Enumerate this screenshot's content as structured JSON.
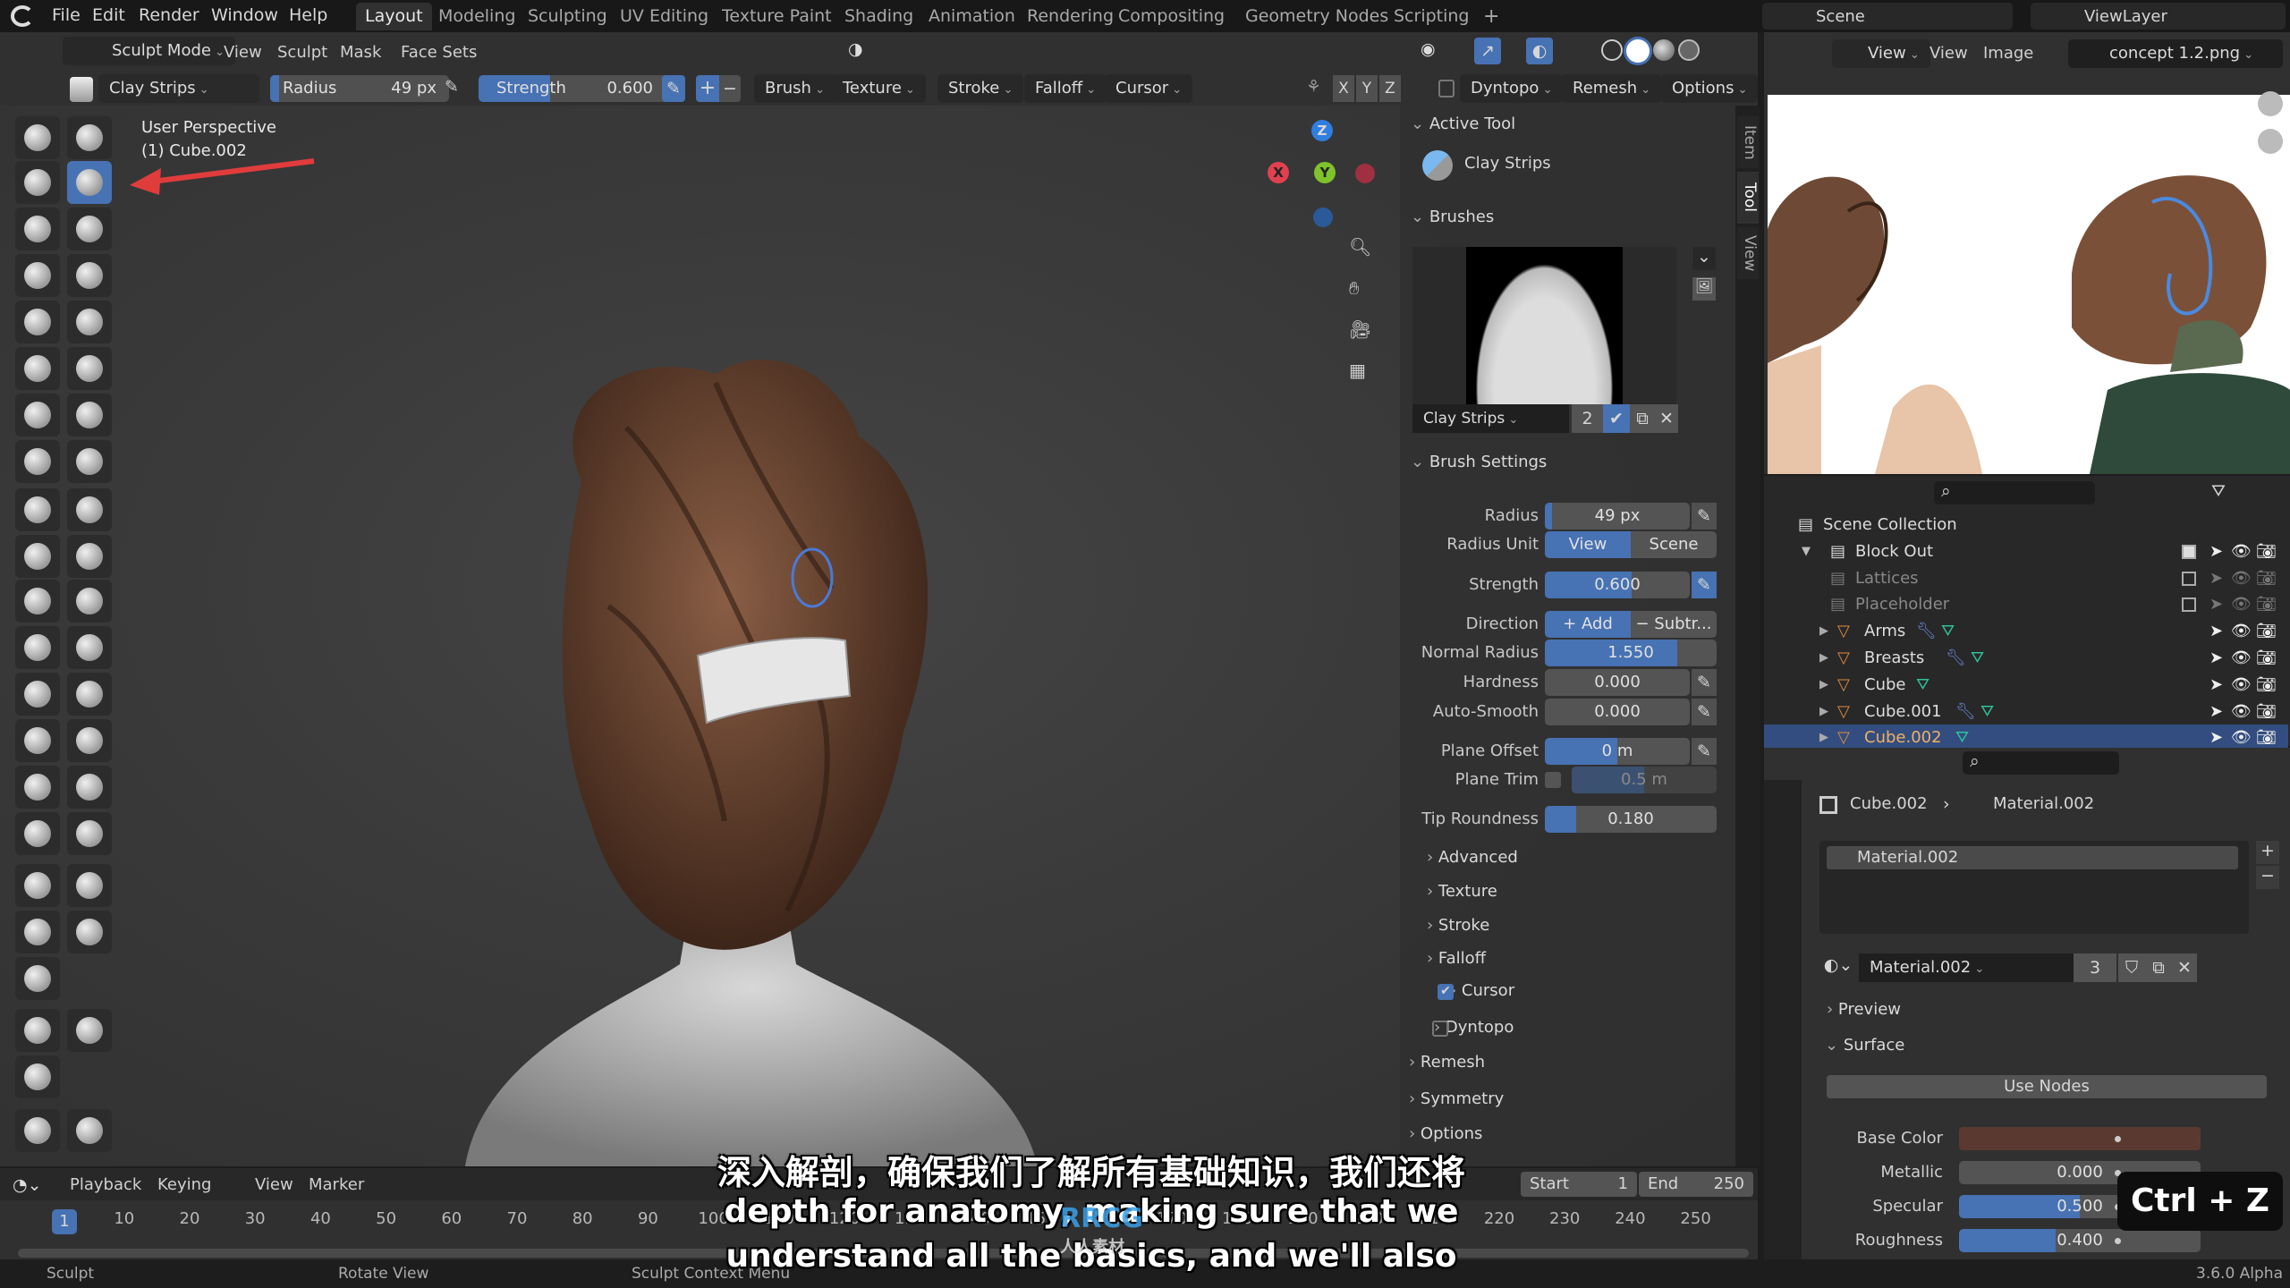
{
  "menu": {
    "items": [
      "File",
      "Edit",
      "Render",
      "Window",
      "Help"
    ]
  },
  "workspaces": {
    "tabs": [
      "Layout",
      "Modeling",
      "Sculpting",
      "UV Editing",
      "Texture Paint",
      "Shading",
      "Animation",
      "Rendering",
      "Compositing",
      "Geometry Nodes",
      "Scripting"
    ],
    "active": "Layout",
    "add": "+"
  },
  "scene": {
    "name": "Scene",
    "view_layer": "ViewLayer"
  },
  "viewport_header": {
    "mode": "Sculpt Mode",
    "menus": [
      "View",
      "Sculpt",
      "Mask",
      "Face Sets"
    ]
  },
  "tool_settings": {
    "brush_name": "Clay Strips",
    "radius_label": "Radius",
    "radius_value": "49 px",
    "strength_label": "Strength",
    "strength_value": "0.600",
    "strength_fraction": 0.6,
    "plus": "+",
    "minus": "−",
    "dropdowns": [
      "Brush",
      "Texture",
      "Stroke",
      "Falloff",
      "Cursor"
    ],
    "axes": [
      "X",
      "Y",
      "Z"
    ],
    "dyntopo": "Dyntopo",
    "remesh": "Remesh",
    "options": "Options"
  },
  "viewport": {
    "perspective": "User Perspective",
    "object": "(1) Cube.002",
    "gizmo": {
      "x": "X",
      "y": "Y",
      "z": "Z"
    },
    "annotation_arrow_color": "#e03c3c"
  },
  "toolbar": {
    "tools": [
      "draw",
      "draw-sharp",
      "clay",
      "clay-strips",
      "clay-thumb",
      "layer",
      "inflate",
      "blob",
      "crease",
      "smooth",
      "flatten",
      "fill",
      "scrape",
      "multiplane-scrape",
      "pinch",
      "grab",
      "elastic-deform",
      "snake-hook",
      "thumb",
      "pose",
      "nudge",
      "rotate",
      "slide-relax",
      "boundary",
      "cloth",
      "simplify",
      "mask",
      "draw-face-sets",
      "multires-eraser",
      "multires-smear",
      "paint",
      "smear",
      "box-mask",
      "box-hide",
      "box-face-set",
      "box-trim",
      "line-project",
      "mesh-filter",
      "cloth-filter",
      "color-filter",
      "transform",
      "annotate"
    ],
    "active": "clay-strips"
  },
  "npanel": {
    "tabs": [
      "Item",
      "Tool",
      "View"
    ],
    "active_tab": "Tool",
    "active_tool_header": "Active Tool",
    "active_tool": "Clay Strips",
    "brushes_header": "Brushes",
    "brush_name": "Clay Strips",
    "brush_users": "2",
    "brush_settings_header": "Brush Settings",
    "fields": [
      {
        "label": "Radius",
        "value": "49 px",
        "fraction": 0.05
      },
      {
        "label": "Radius Unit",
        "options": [
          "View",
          "Scene"
        ],
        "selected": "View"
      },
      {
        "label": "Strength",
        "value": "0.600",
        "fraction": 0.6
      },
      {
        "label": "Direction",
        "options": [
          "+   Add",
          "−  Subtr..."
        ],
        "selected": "+   Add"
      },
      {
        "label": "Normal Radius",
        "value": "1.550",
        "fraction": 0.77
      },
      {
        "label": "Hardness",
        "value": "0.000",
        "fraction": 0
      },
      {
        "label": "Auto-Smooth",
        "value": "0.000",
        "fraction": 0
      },
      {
        "label": "Plane Offset",
        "value": "0 m",
        "fraction": 0.5
      },
      {
        "label": "Plane Trim",
        "value": "0.5 m",
        "fraction": 0.5,
        "checked": false
      },
      {
        "label": "Tip Roundness",
        "value": "0.180",
        "fraction": 0.18
      }
    ],
    "subsections": [
      {
        "label": "Advanced"
      },
      {
        "label": "Texture"
      },
      {
        "label": "Stroke"
      },
      {
        "label": "Falloff"
      },
      {
        "label": "Cursor",
        "checked": true
      }
    ],
    "sections": [
      {
        "label": "Dyntopo",
        "checked": false
      },
      {
        "label": "Remesh"
      },
      {
        "label": "Symmetry"
      },
      {
        "label": "Options"
      }
    ]
  },
  "image_editor": {
    "view_mode": "View",
    "menus": [
      "View",
      "Image"
    ],
    "image": "concept 1.2.png"
  },
  "outliner": {
    "rows": [
      {
        "name": "Scene Collection",
        "type": "collection",
        "level": 0
      },
      {
        "name": "Block Out",
        "type": "collection",
        "level": 1,
        "checked": true
      },
      {
        "name": "Lattices",
        "type": "collection",
        "level": 2,
        "checked": false,
        "dim": true
      },
      {
        "name": "Placeholder",
        "type": "collection",
        "level": 2,
        "checked": false,
        "dim": true
      },
      {
        "name": "Arms",
        "type": "mesh",
        "level": 2,
        "modifier": true
      },
      {
        "name": "Breasts",
        "type": "mesh",
        "level": 2,
        "modifier": true
      },
      {
        "name": "Cube",
        "type": "mesh",
        "level": 2,
        "modifier": false
      },
      {
        "name": "Cube.001",
        "type": "mesh",
        "level": 2,
        "modifier": true
      },
      {
        "name": "Cube.002",
        "type": "mesh",
        "level": 2,
        "modifier": false,
        "selected": true
      }
    ]
  },
  "properties": {
    "object": "Cube.002",
    "material": "Material.002",
    "slots": [
      "Material.002"
    ],
    "datablock": "Material.002",
    "users": "3",
    "panels": {
      "preview": "Preview",
      "surface": "Surface"
    },
    "use_nodes": "Use Nodes",
    "fields": [
      {
        "label": "Base Color",
        "color": "#5a3a30"
      },
      {
        "label": "Metallic",
        "value": "0.000",
        "fraction": 0
      },
      {
        "label": "Specular",
        "value": "0.500",
        "fraction": 0.5
      },
      {
        "label": "Roughness",
        "value": "0.400",
        "fraction": 0.4
      }
    ]
  },
  "timeline": {
    "menus": [
      "Playback",
      "Keying",
      "View",
      "Marker"
    ],
    "current_frame": "1",
    "start_label": "Start",
    "start": "1",
    "end_label": "End",
    "end": "250",
    "ticks": [
      "10",
      "20",
      "30",
      "40",
      "50",
      "60",
      "70",
      "80",
      "90",
      "100",
      "110",
      "120",
      "130",
      "140",
      "150",
      "160",
      "170",
      "180",
      "190",
      "200",
      "210",
      "220",
      "230",
      "240",
      "250"
    ]
  },
  "status": {
    "items": [
      "Sculpt",
      "Rotate View",
      "Sculpt Context Menu"
    ],
    "version": "3.6.0 Alpha"
  },
  "overlay": {
    "subtitle_zh": "深入解剖，确保我们了解所有基础知识，我们还将",
    "subtitle_en_1": "depth for anatomy, making sure that we",
    "subtitle_en_2": "understand all the basics, and we'll also",
    "shortcut": "Ctrl + Z",
    "watermark": "RRCG",
    "watermark_zh": "人人素材"
  },
  "colors": {
    "accent": "#4772b3",
    "selection": "#334d80",
    "mesh_icon": "#e08a3c",
    "data_icon": "#2ec29a",
    "modifier_icon": "#6a86d8"
  }
}
